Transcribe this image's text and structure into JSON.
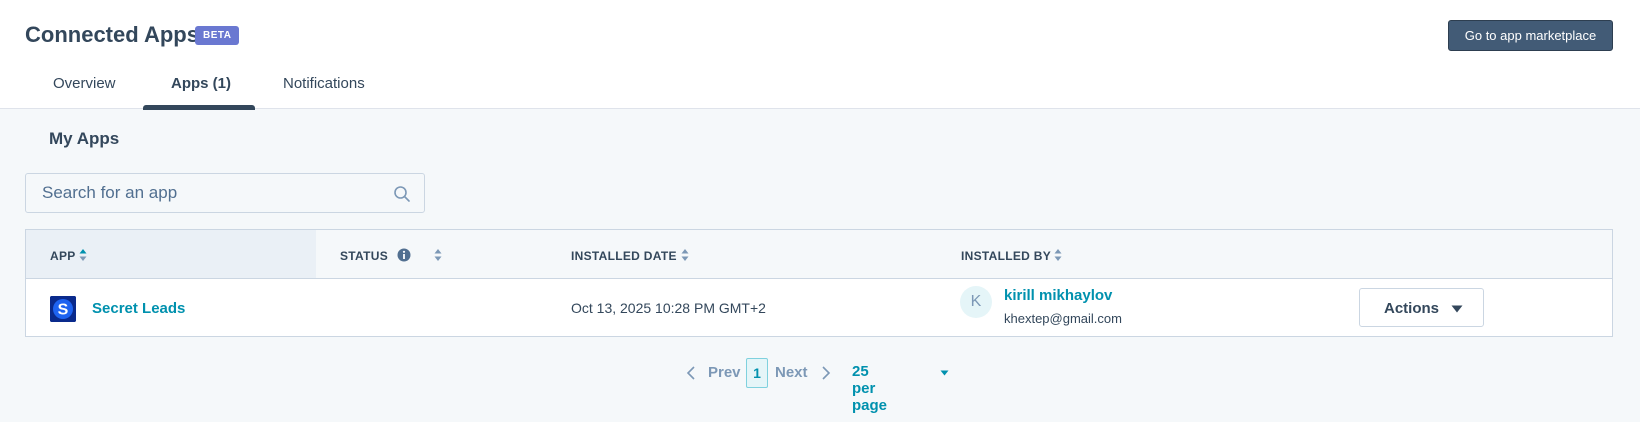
{
  "header": {
    "title": "Connected Apps",
    "badge": "BETA",
    "marketplace_button": "Go to app marketplace",
    "tabs": [
      {
        "label": "Overview",
        "active": false
      },
      {
        "label": "Apps (1)",
        "active": true
      },
      {
        "label": "Notifications",
        "active": false
      }
    ]
  },
  "main": {
    "section_title": "My Apps",
    "search": {
      "placeholder": "Search for an app",
      "value": ""
    },
    "table": {
      "columns": [
        "APP",
        "STATUS",
        "INSTALLED DATE",
        "INSTALLED BY"
      ],
      "rows": [
        {
          "app_logo_letter": "S",
          "app_name": "Secret Leads",
          "status": "",
          "installed_date": "Oct 13, 2025 10:28 PM GMT+2",
          "installer_initial": "K",
          "installer_name": "kirill mikhaylov",
          "installer_email": "khextep@gmail.com",
          "actions_label": "Actions"
        }
      ]
    },
    "pagination": {
      "prev": "Prev",
      "current_page": "1",
      "next": "Next",
      "per_page": "25 per page"
    }
  },
  "colors": {
    "primary_text": "#33475b",
    "link": "#0091ae",
    "badge": "#6a78d1",
    "dark_button": "#425b76"
  },
  "icons": {
    "search": "search-icon",
    "info": "info-icon",
    "sort": "sort-icon",
    "caret": "caret-down-icon",
    "prev": "chevron-left-icon",
    "next": "chevron-right-icon"
  }
}
